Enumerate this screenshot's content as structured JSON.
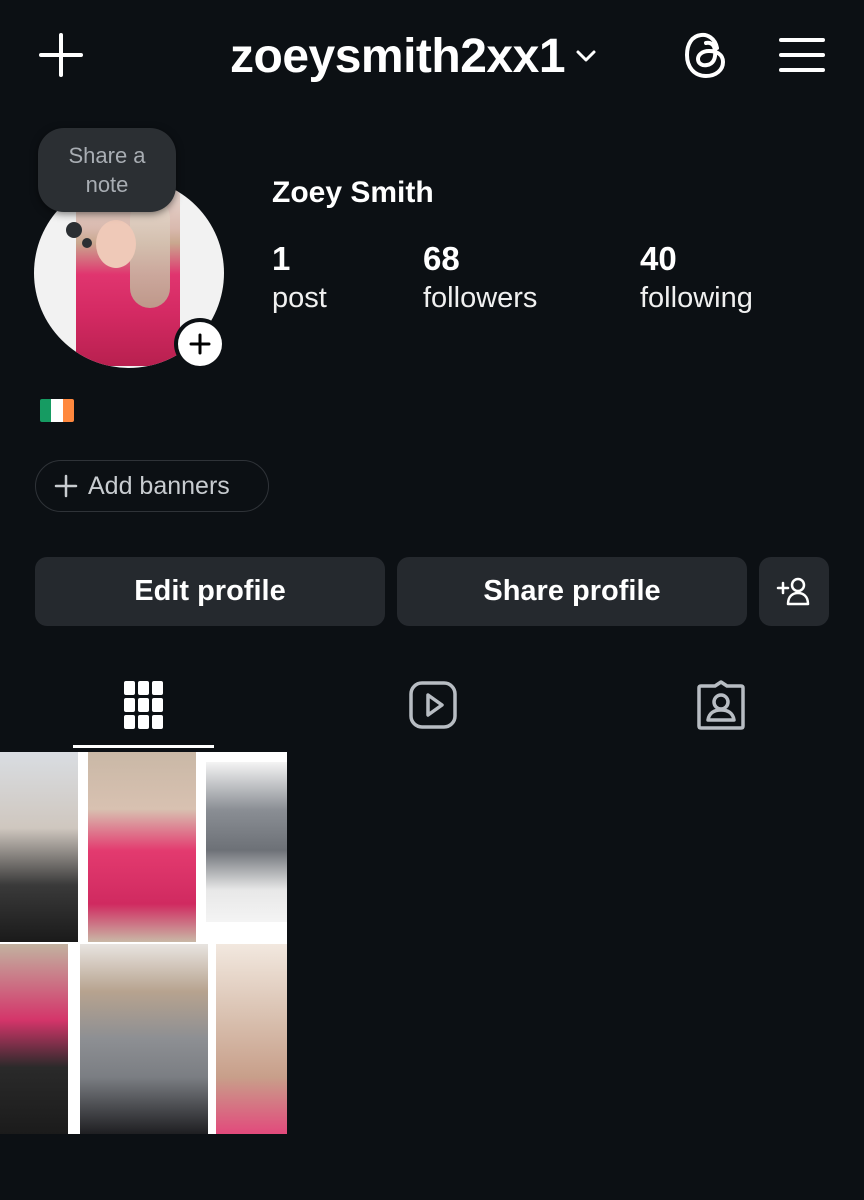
{
  "header": {
    "username": "zoeysmith2xx1",
    "new_icon": "plus-icon",
    "switch_icon": "chevron-down-icon",
    "threads_icon": "threads-icon",
    "menu_icon": "hamburger-menu-icon"
  },
  "profile": {
    "note_prompt": "Share a note",
    "full_name": "Zoey Smith",
    "bio_flag": "Ireland flag",
    "stats": [
      {
        "value": "1",
        "label": "post"
      },
      {
        "value": "68",
        "label": "followers"
      },
      {
        "value": "40",
        "label": "following"
      }
    ]
  },
  "banners_label": "Add banners",
  "actions": {
    "edit_label": "Edit profile",
    "share_label": "Share profile",
    "add_user_icon": "add-person-icon"
  },
  "tabs": [
    {
      "icon": "grid-icon",
      "active": true
    },
    {
      "icon": "reels-icon",
      "active": false
    },
    {
      "icon": "tagged-icon",
      "active": false
    }
  ],
  "colors": {
    "background": "#0c1014",
    "button": "#25292e",
    "text": "#ffffff",
    "accent_pink": "#e0356f"
  },
  "posts": [
    {
      "id": "photo-collage-post"
    }
  ]
}
